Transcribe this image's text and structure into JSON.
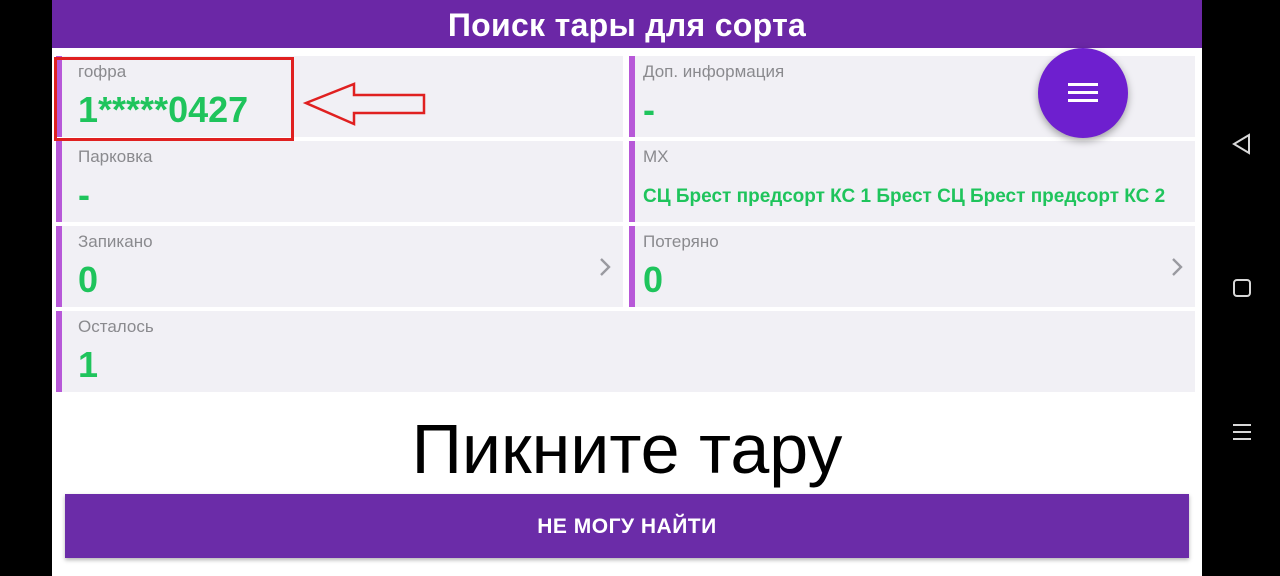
{
  "header": {
    "title": "Поиск тары для сорта"
  },
  "cards": {
    "gofra": {
      "label": "гофра",
      "value": "1*****0427"
    },
    "dop_info": {
      "label": "Доп. информация",
      "value": "-"
    },
    "parkovka": {
      "label": "Парковка",
      "value": "-"
    },
    "mx": {
      "label": "МХ",
      "value": "СЦ Брест предсорт КС 1 Брест СЦ Брест предсорт КС 2"
    },
    "zapikano": {
      "label": "Запикано",
      "value": "0"
    },
    "poteryano": {
      "label": "Потеряно",
      "value": "0"
    },
    "ostalos": {
      "label": "Осталось",
      "value": "1"
    }
  },
  "main": {
    "prompt": "Пикните тару"
  },
  "actions": {
    "cant_find_label": "НЕ МОГУ НАЙТИ"
  },
  "icons": {
    "fab": "menu-icon",
    "chevrons": "chevron-right-icon",
    "nav_back": "back-triangle-icon",
    "nav_home": "home-square-icon",
    "nav_menu": "menu-lines-icon",
    "annotation": "arrow-left-icon"
  },
  "colors": {
    "primary": "#6b27a6",
    "accent_bar": "#b758d8",
    "value_green": "#1fc45c",
    "fab": "#6e1fcf",
    "highlight": "#e02020"
  }
}
